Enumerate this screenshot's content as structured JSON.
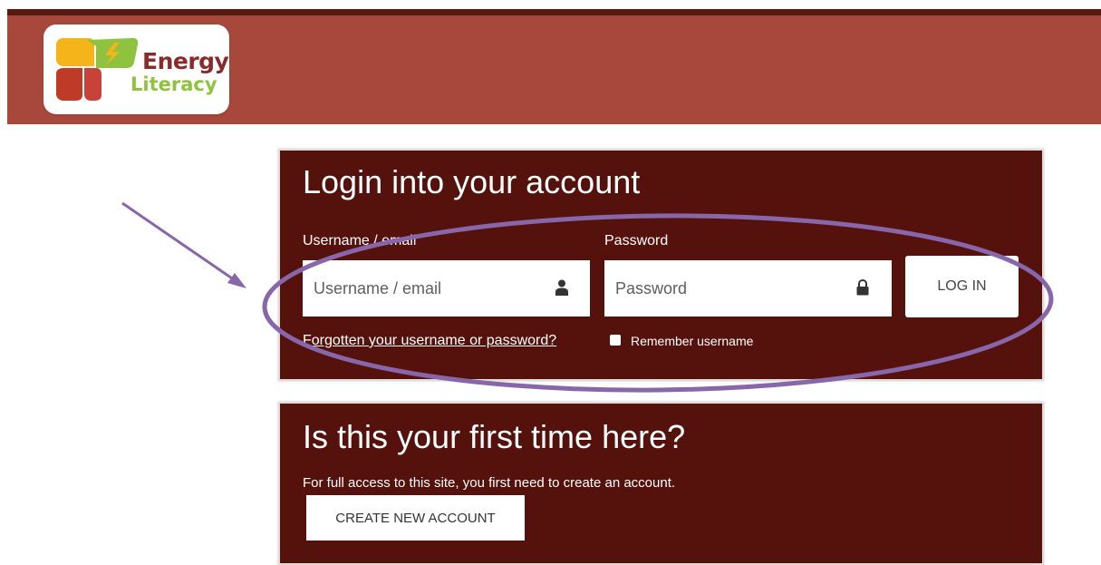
{
  "logo": {
    "line1": "Energy",
    "line2": "Literacy"
  },
  "login": {
    "title": "Login into your account",
    "username_label": "Username / email",
    "username_placeholder": "Username / email",
    "password_label": "Password",
    "password_placeholder": "Password",
    "login_button": "LOG IN",
    "forgot_link": "Forgotten your username or password?",
    "remember_label": "Remember username"
  },
  "signup": {
    "title": "Is this your first time here?",
    "description": "For full access to this site, you first need to create an account.",
    "create_button": "CREATE NEW ACCOUNT"
  },
  "colors": {
    "header": "#a8473b",
    "panel": "#55120c",
    "annotation": "#8866aa"
  },
  "icons": {
    "username_field": "user-icon",
    "password_field": "lock-icon"
  }
}
